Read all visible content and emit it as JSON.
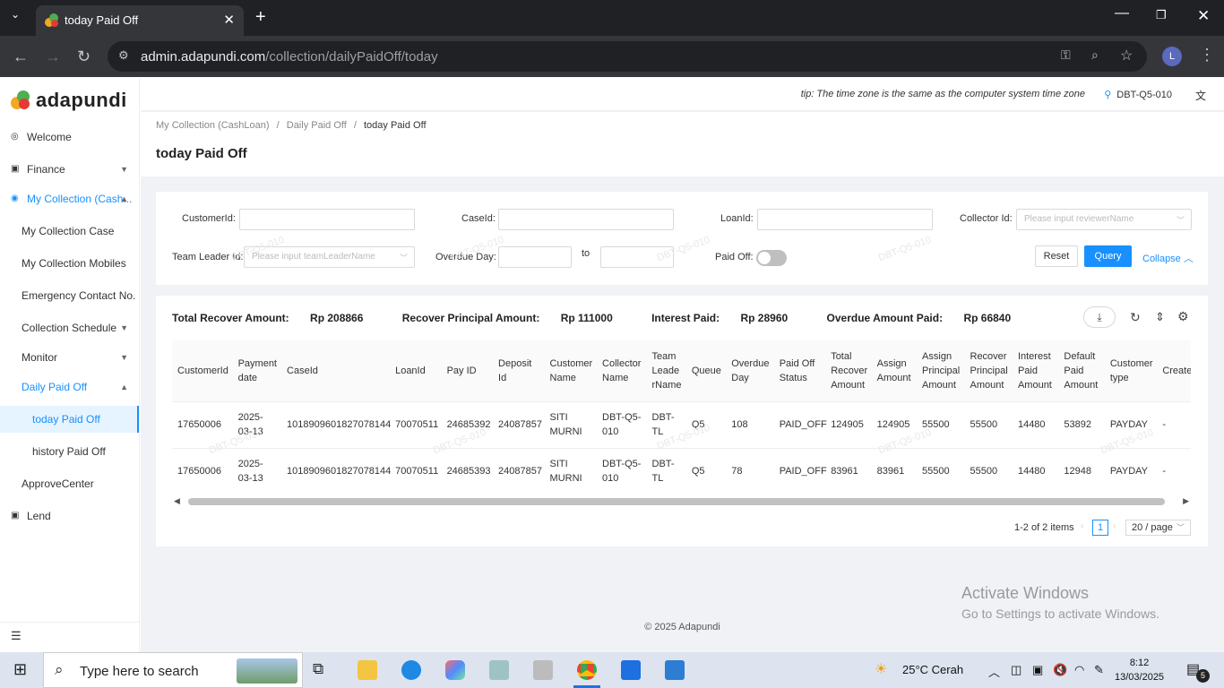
{
  "browser": {
    "tab_title": "today Paid Off",
    "url_domain": "admin.adapundi.com",
    "url_path": "/collection/dailyPaidOff/today",
    "profile_initial": "L"
  },
  "sidebar": {
    "logo": "adapundi",
    "items": [
      {
        "label": "Welcome"
      },
      {
        "label": "Finance"
      },
      {
        "label": "My Collection (Cash..."
      },
      {
        "label": "My Collection Case"
      },
      {
        "label": "My Collection Mobiles"
      },
      {
        "label": "Emergency Contact No."
      },
      {
        "label": "Collection Schedule"
      },
      {
        "label": "Monitor"
      },
      {
        "label": "Daily Paid Off"
      },
      {
        "label": "today Paid Off"
      },
      {
        "label": "history Paid Off"
      },
      {
        "label": "ApproveCenter"
      },
      {
        "label": "Lend"
      }
    ]
  },
  "topbar": {
    "tip": "tip: The time zone is the same as the computer system time zone",
    "user": "DBT-Q5-010"
  },
  "breadcrumb": {
    "b1": "My Collection (CashLoan)",
    "b2": "Daily Paid Off",
    "b3": "today Paid Off"
  },
  "page_title": "today Paid Off",
  "filters": {
    "customer_id": "CustomerId:",
    "case_id": "CaseId:",
    "loan_id": "LoanId:",
    "collector_id": "Collector Id:",
    "collector_placeholder": "Please input reviewerName",
    "team_leader_id": "Team Leader Id:",
    "team_leader_placeholder": "Please input teamLeaderName",
    "overdue_day": "Overdue Day:",
    "to": "to",
    "paid_off": "Paid Off:",
    "reset": "Reset",
    "query": "Query",
    "collapse": "Collapse"
  },
  "summary": {
    "total_recover_label": "Total Recover Amount:",
    "total_recover_value": "Rp 208866",
    "recover_principal_label": "Recover Principal Amount:",
    "recover_principal_value": "Rp 111000",
    "interest_paid_label": "Interest Paid:",
    "interest_paid_value": "Rp 28960",
    "overdue_paid_label": "Overdue Amount Paid:",
    "overdue_paid_value": "Rp 66840"
  },
  "table": {
    "headers": [
      "CustomerId",
      "Payment date",
      "CaseId",
      "LoanId",
      "Pay ID",
      "Deposit Id",
      "Customer Name",
      "Collector Name",
      "Team Leade rName",
      "Queue",
      "Overdue Day",
      "Paid Off Status",
      "Total Recover Amount",
      "Assign Amount",
      "Assign Principal Amount",
      "Recover Principal Amount",
      "Interest Paid Amount",
      "Default Paid Amount",
      "Customer type",
      "CreateTim"
    ],
    "rows": [
      [
        "17650006",
        "2025-03-13",
        "1018909601827078144",
        "70070511",
        "24685392",
        "24087857",
        "SITI MURNI",
        "DBT-Q5-010",
        "DBT-TL",
        "Q5",
        "108",
        "PAID_OFF",
        "124905",
        "124905",
        "55500",
        "55500",
        "14480",
        "53892",
        "PAYDAY",
        "-"
      ],
      [
        "17650006",
        "2025-03-13",
        "1018909601827078144",
        "70070511",
        "24685393",
        "24087857",
        "SITI MURNI",
        "DBT-Q5-010",
        "DBT-TL",
        "Q5",
        "78",
        "PAID_OFF",
        "83961",
        "83961",
        "55500",
        "55500",
        "14480",
        "12948",
        "PAYDAY",
        "-"
      ]
    ]
  },
  "pagination": {
    "summary": "1-2 of 2 items",
    "current": "1",
    "page_size": "20 / page"
  },
  "footer": "© 2025 Adapundi",
  "watermark": "DBT-Q5-010",
  "activate": {
    "line1": "Activate Windows",
    "line2": "Go to Settings to activate Windows."
  },
  "taskbar": {
    "search": "Type here to search",
    "weather": "25°C  Cerah",
    "time": "8:12",
    "date": "13/03/2025",
    "notif_count": "5"
  }
}
